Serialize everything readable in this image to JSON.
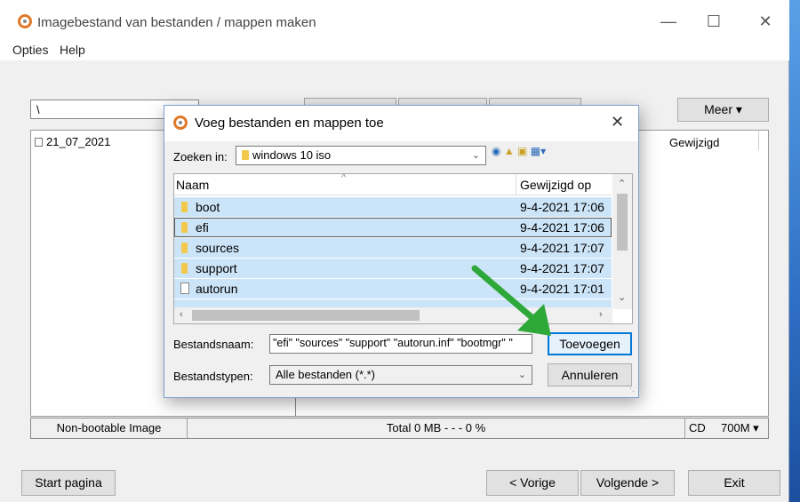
{
  "window": {
    "title": "Imagebestand van bestanden / mappen maken",
    "controls": {
      "minimize": "—",
      "maximize": "☐",
      "close": "✕"
    }
  },
  "menu": {
    "items": [
      "Opties",
      "Help"
    ]
  },
  "toolbar": {
    "path": "\\",
    "more_label": "Meer ▾"
  },
  "content": {
    "entries": [
      {
        "name": "21_07_2021"
      }
    ],
    "columns": {
      "modified": "Gewijzigd"
    }
  },
  "status": {
    "boot": "Non-bootable Image",
    "total": "Total  0 MB   - - -  0 %",
    "media": "CD",
    "size": "700M ▾"
  },
  "buttons": {
    "start": "Start pagina",
    "prev": "< Vorige",
    "next": "Volgende >",
    "exit": "Exit"
  },
  "dialog": {
    "title": "Voeg bestanden en mappen toe",
    "close": "✕",
    "look_in_label": "Zoeken in:",
    "look_in_value": "windows 10 iso",
    "columns": {
      "name": "Naam",
      "modified": "Gewijzigd op"
    },
    "rows": [
      {
        "name": "boot",
        "date": "9-4-2021 17:06",
        "type": "folder"
      },
      {
        "name": "efi",
        "date": "9-4-2021 17:06",
        "type": "folder"
      },
      {
        "name": "sources",
        "date": "9-4-2021 17:07",
        "type": "folder"
      },
      {
        "name": "support",
        "date": "9-4-2021 17:07",
        "type": "folder"
      },
      {
        "name": "autorun",
        "date": "9-4-2021 17:01",
        "type": "file"
      }
    ],
    "filename_label": "Bestandsnaam:",
    "filename_value": "\"efi\" \"sources\" \"support\" \"autorun.inf\" \"bootmgr\" \"",
    "filetype_label": "Bestandstypen:",
    "filetype_value": "Alle bestanden (*.*)",
    "add_button": "Toevoegen",
    "cancel_button": "Annuleren"
  },
  "colors": {
    "selection": "#cce4f7",
    "accent": "#0078d7",
    "arrow": "#2fa83a"
  }
}
